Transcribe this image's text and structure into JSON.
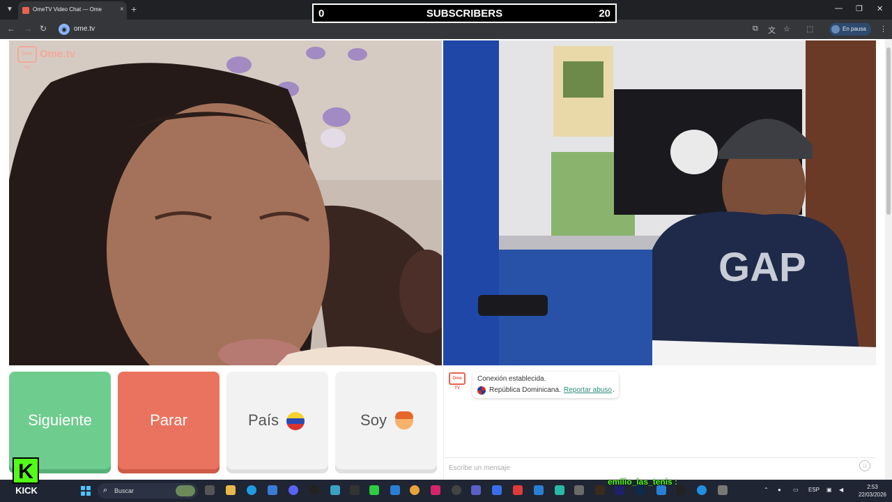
{
  "browser": {
    "tab_title": "OmeTV Video Chat — Ome",
    "tab_close": "×",
    "new_tab": "+",
    "url": "ome.tv",
    "profile_label": "En pausa",
    "win_minimize": "—",
    "win_restore": "❐",
    "win_close": "✕"
  },
  "overlay": {
    "left_count": "0",
    "label": "SUBSCRIBERS",
    "right_count": "20"
  },
  "app": {
    "logo_box": "Ome TV",
    "logo_text": "Ome.tv",
    "buttons": {
      "next": "Siguiente",
      "stop": "Parar",
      "country": "País",
      "gender": "Soy"
    },
    "flag_colors": {
      "yellow": "#f7d22c",
      "blue": "#2b4bb3",
      "red": "#d8332f"
    }
  },
  "chat": {
    "logo": "Ome TV",
    "connection_message": "Conexión establecida.",
    "country": "República Dominicana.",
    "report_link": "Reportar abuso",
    "report_suffix": ".",
    "input_placeholder": "Escribe un mensaje",
    "emoji_icon": "☺"
  },
  "stream": {
    "kick_logo_letter": "K",
    "kick_text": "KICK",
    "chat_user": "emilio_las_tenis :"
  },
  "taskbar": {
    "search_placeholder": "Buscar",
    "keyboard_lang": "ESP",
    "time": "2:53",
    "date": "22/03/2026"
  }
}
